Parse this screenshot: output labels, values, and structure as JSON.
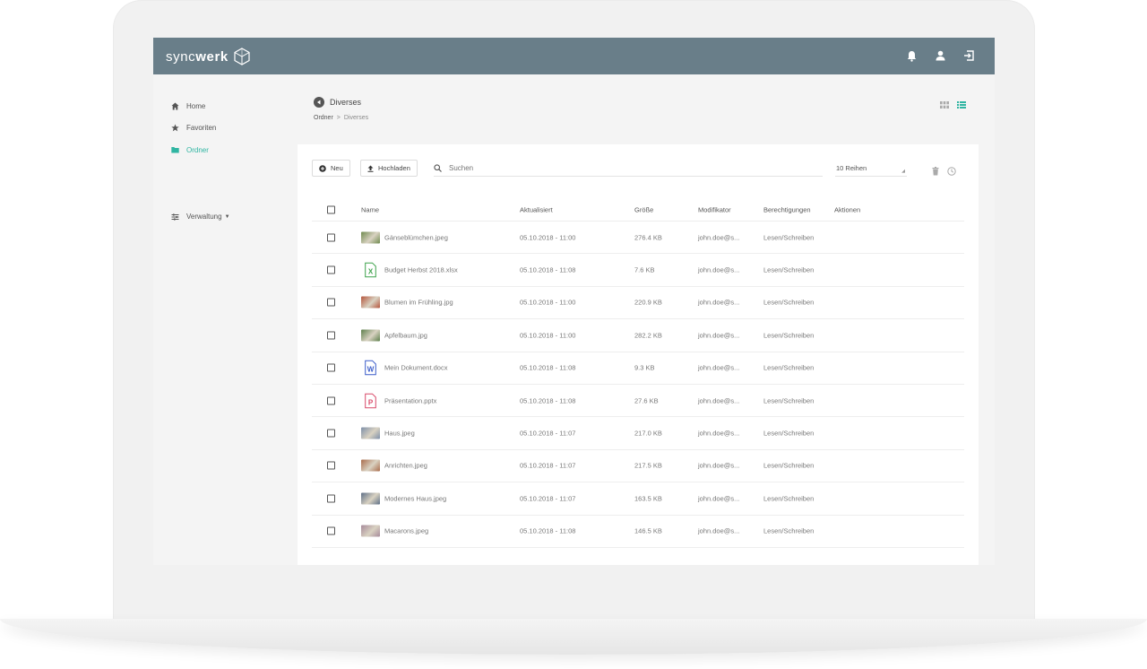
{
  "app": {
    "logo_light": "sync",
    "logo_bold": "werk",
    "header_icons": [
      "bell-icon",
      "user-icon",
      "logout-icon"
    ]
  },
  "sidebar": {
    "items": [
      {
        "label": "Home",
        "icon": "home-icon",
        "active": false
      },
      {
        "label": "Favoriten",
        "icon": "star-icon",
        "active": false
      },
      {
        "label": "Ordner",
        "icon": "folder-icon",
        "active": true
      }
    ],
    "admin_label": "Verwaltung"
  },
  "page": {
    "title": "Diverses",
    "breadcrumb": [
      "Ordner",
      "Diverses"
    ],
    "breadcrumb_sep": ">"
  },
  "toolbar": {
    "new_label": "Neu",
    "upload_label": "Hochladen",
    "search_placeholder": "Suchen",
    "rows_value": "10 Reihen"
  },
  "table": {
    "headers": [
      "Name",
      "Aktualisiert",
      "Größe",
      "Modifikator",
      "Berechtigungen",
      "Aktionen"
    ],
    "rows": [
      {
        "name": "Gänseblümchen.jpeg",
        "updated": "05.10.2018 - 11:00",
        "size": "276.4 KB",
        "modifier": "john.doe@s...",
        "perm": "Lesen/Schreiben",
        "type": "image",
        "color": "#6f8a4e"
      },
      {
        "name": "Budget Herbst 2018.xlsx",
        "updated": "05.10.2018 - 11:08",
        "size": "7.6 KB",
        "modifier": "john.doe@s...",
        "perm": "Lesen/Schreiben",
        "type": "excel",
        "color": "#3fa34d"
      },
      {
        "name": "Blumen im Frühling.jpg",
        "updated": "05.10.2018 - 11:00",
        "size": "220.9 KB",
        "modifier": "john.doe@s...",
        "perm": "Lesen/Schreiben",
        "type": "image",
        "color": "#b4553c"
      },
      {
        "name": "Apfelbaum.jpg",
        "updated": "05.10.2018 - 11:00",
        "size": "282.2 KB",
        "modifier": "john.doe@s...",
        "perm": "Lesen/Schreiben",
        "type": "image",
        "color": "#5c7e4a"
      },
      {
        "name": "Mein Dokument.docx",
        "updated": "05.10.2018 - 11:08",
        "size": "9.3 KB",
        "modifier": "john.doe@s...",
        "perm": "Lesen/Schreiben",
        "type": "word",
        "color": "#3b5dc9"
      },
      {
        "name": "Präsentation.pptx",
        "updated": "05.10.2018 - 11:08",
        "size": "27.6 KB",
        "modifier": "john.doe@s...",
        "perm": "Lesen/Schreiben",
        "type": "powerpoint",
        "color": "#d94b6a"
      },
      {
        "name": "Haus.jpeg",
        "updated": "05.10.2018 - 11:07",
        "size": "217.0 KB",
        "modifier": "john.doe@s...",
        "perm": "Lesen/Schreiben",
        "type": "image",
        "color": "#7d8fa8"
      },
      {
        "name": "Anrichten.jpeg",
        "updated": "05.10.2018 - 11:07",
        "size": "217.5 KB",
        "modifier": "john.doe@s...",
        "perm": "Lesen/Schreiben",
        "type": "image",
        "color": "#a86b4a"
      },
      {
        "name": "Modernes Haus.jpeg",
        "updated": "05.10.2018 - 11:07",
        "size": "163.5 KB",
        "modifier": "john.doe@s...",
        "perm": "Lesen/Schreiben",
        "type": "image",
        "color": "#5e6f86"
      },
      {
        "name": "Macarons.jpeg",
        "updated": "05.10.2018 - 11:08",
        "size": "146.5 KB",
        "modifier": "john.doe@s...",
        "perm": "Lesen/Schreiben",
        "type": "image",
        "color": "#a68a9a"
      }
    ]
  },
  "colors": {
    "header_bg": "#697e89",
    "accent": "#2fb5a2"
  }
}
